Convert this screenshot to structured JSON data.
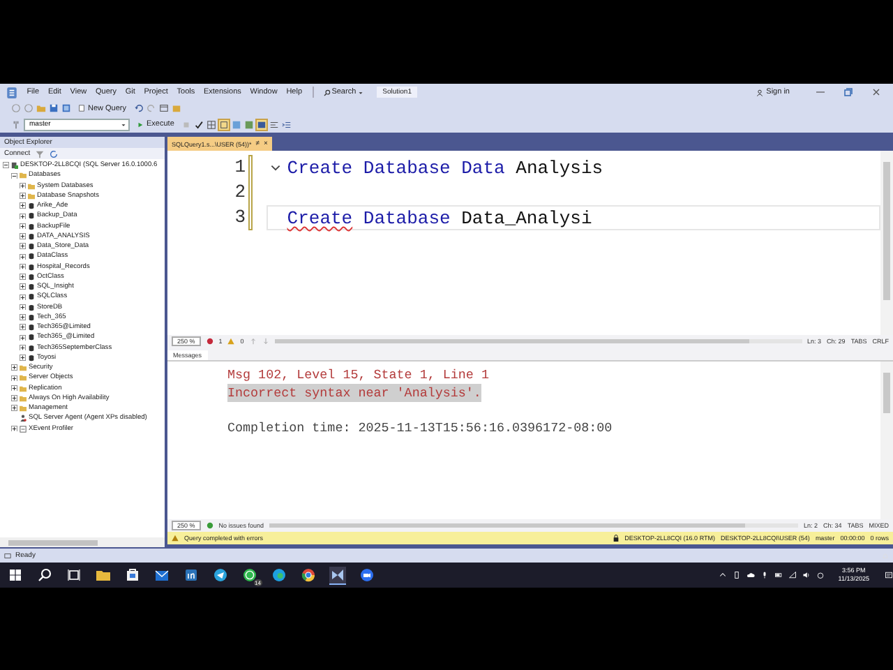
{
  "menu": [
    "File",
    "Edit",
    "View",
    "Query",
    "Git",
    "Project",
    "Tools",
    "Extensions",
    "Window",
    "Help"
  ],
  "search": "Search",
  "solution": "Solution1",
  "sign_in": "Sign in",
  "toolbar": {
    "new_query": "New Query",
    "database": "master",
    "execute": "Execute"
  },
  "object_explorer": {
    "title": "Object Explorer",
    "connect": "Connect",
    "tree": [
      {
        "label": "DESKTOP-2LL8CQI (SQL Server 16.0.1000.6",
        "kind": "server",
        "expanded": true,
        "children": [
          {
            "label": "Databases",
            "kind": "folder",
            "expanded": true,
            "children": [
              {
                "label": "System Databases",
                "kind": "folder",
                "expanded": false
              },
              {
                "label": "Database Snapshots",
                "kind": "folder",
                "expanded": false
              },
              {
                "label": "Arike_Ade",
                "kind": "database",
                "expanded": false
              },
              {
                "label": "Backup_Data",
                "kind": "database",
                "expanded": false
              },
              {
                "label": "BackupFile",
                "kind": "database",
                "expanded": false
              },
              {
                "label": "DATA_ANALYSIS",
                "kind": "database",
                "expanded": false
              },
              {
                "label": "Data_Store_Data",
                "kind": "database",
                "expanded": false
              },
              {
                "label": "DataClass",
                "kind": "database",
                "expanded": false
              },
              {
                "label": "Hospital_Records",
                "kind": "database",
                "expanded": false
              },
              {
                "label": "OctClass",
                "kind": "database",
                "expanded": false
              },
              {
                "label": "SQL_Insight",
                "kind": "database",
                "expanded": false
              },
              {
                "label": "SQLClass",
                "kind": "database",
                "expanded": false
              },
              {
                "label": "StoreDB",
                "kind": "database",
                "expanded": false
              },
              {
                "label": "Tech_365",
                "kind": "database",
                "expanded": false
              },
              {
                "label": "Tech365@Limited",
                "kind": "database",
                "expanded": false
              },
              {
                "label": "Tech365_@Limited",
                "kind": "database",
                "expanded": false
              },
              {
                "label": "Tech365SeptemberClass",
                "kind": "database",
                "expanded": false
              },
              {
                "label": "Toyosi",
                "kind": "database",
                "expanded": false
              }
            ]
          },
          {
            "label": "Security",
            "kind": "folder",
            "expanded": false
          },
          {
            "label": "Server Objects",
            "kind": "folder",
            "expanded": false
          },
          {
            "label": "Replication",
            "kind": "folder",
            "expanded": false
          },
          {
            "label": "Always On High Availability",
            "kind": "folder",
            "expanded": false
          },
          {
            "label": "Management",
            "kind": "folder",
            "expanded": false
          },
          {
            "label": "SQL Server Agent (Agent XPs disabled)",
            "kind": "agent"
          },
          {
            "label": "XEvent Profiler",
            "kind": "xevent",
            "expanded": false
          }
        ]
      }
    ]
  },
  "editor_tab": {
    "title": "SQLQuery1.s...\\USER (54))*",
    "pin": "≠",
    "close": "×"
  },
  "lines": [
    {
      "number": "1",
      "current": false,
      "foldable": true,
      "tokens": [
        {
          "text": "Create",
          "kind": "keyword",
          "error": false
        },
        {
          "text": "Database",
          "kind": "keyword",
          "error": false
        },
        {
          "text": "Data",
          "kind": "keyword",
          "error": false
        },
        {
          "text": "Analysis",
          "kind": "identifier",
          "error": false
        }
      ]
    },
    {
      "number": "2",
      "current": false,
      "foldable": false
    },
    {
      "number": "3",
      "current": true,
      "foldable": false,
      "tokens": [
        {
          "text": "Create",
          "kind": "keyword",
          "error": true
        },
        {
          "text": "Database",
          "kind": "keyword",
          "error": false
        },
        {
          "text": "Data_Analysi",
          "kind": "identifier",
          "error": false
        }
      ]
    }
  ],
  "editor_status": {
    "zoom": "250 %",
    "errors": "1",
    "warnings": "0",
    "line": "Ln: 3",
    "column": "Ch: 29",
    "indent": "TABS",
    "line_ending": "CRLF"
  },
  "results_tab": "Messages",
  "messages": [
    {
      "text": "Msg 102, Level 15, State 1, Line 1",
      "kind": "error",
      "selected": false
    },
    {
      "text": "Incorrect syntax near 'Analysis'.",
      "kind": "error",
      "selected": true
    },
    {
      "text": "Completion time: 2025-11-13T15:56:16.0396172-08:00",
      "kind": "info",
      "selected": false
    }
  ],
  "results_status": {
    "zoom": "250 %",
    "issues": "No issues found",
    "line": "Ln: 2",
    "column": "Ch: 34",
    "indent": "TABS",
    "line_ending": "MIXED"
  },
  "query_status": {
    "message": "Query completed with errors",
    "server": "DESKTOP-2LL8CQI (16.0 RTM)",
    "user": "DESKTOP-2LL8CQI\\USER (54)",
    "database": "master",
    "elapsed": "00:00:00",
    "rows": "0 rows"
  },
  "app_status": "Ready",
  "taskbar": {
    "whatsapp_badge": "14",
    "time": "3:56 PM",
    "date": "11/13/2025"
  }
}
